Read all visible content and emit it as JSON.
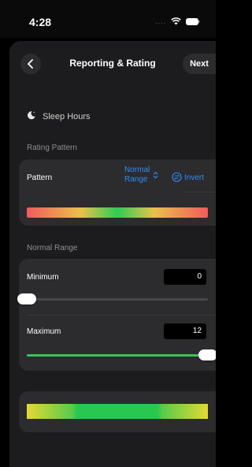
{
  "status_bar": {
    "time": "4:28",
    "signal_dots": "...."
  },
  "nav": {
    "title": "Reporting & Rating",
    "next_label": "Next"
  },
  "metric": {
    "label": "Sleep Hours",
    "icon": "moon-icon"
  },
  "rating_pattern": {
    "section_label": "Rating Pattern",
    "pattern_label": "Pattern",
    "pattern_value_line1": "Normal",
    "pattern_value_line2": "Range",
    "invert_label": "Invert",
    "colors": {
      "low": "#f15b5b",
      "mid": "#e9c24a",
      "good": "#2ecc55"
    }
  },
  "normal_range": {
    "section_label": "Normal Range",
    "minimum_label": "Minimum",
    "minimum_value": "0",
    "minimum_slider_fraction": 0,
    "maximum_label": "Maximum",
    "maximum_value": "12",
    "maximum_slider_fraction": 1
  },
  "theme": {
    "accent": "#2f8cf5",
    "slider_green": "#34c759",
    "background": "#1c1c1e",
    "card": "#2c2c2e"
  }
}
